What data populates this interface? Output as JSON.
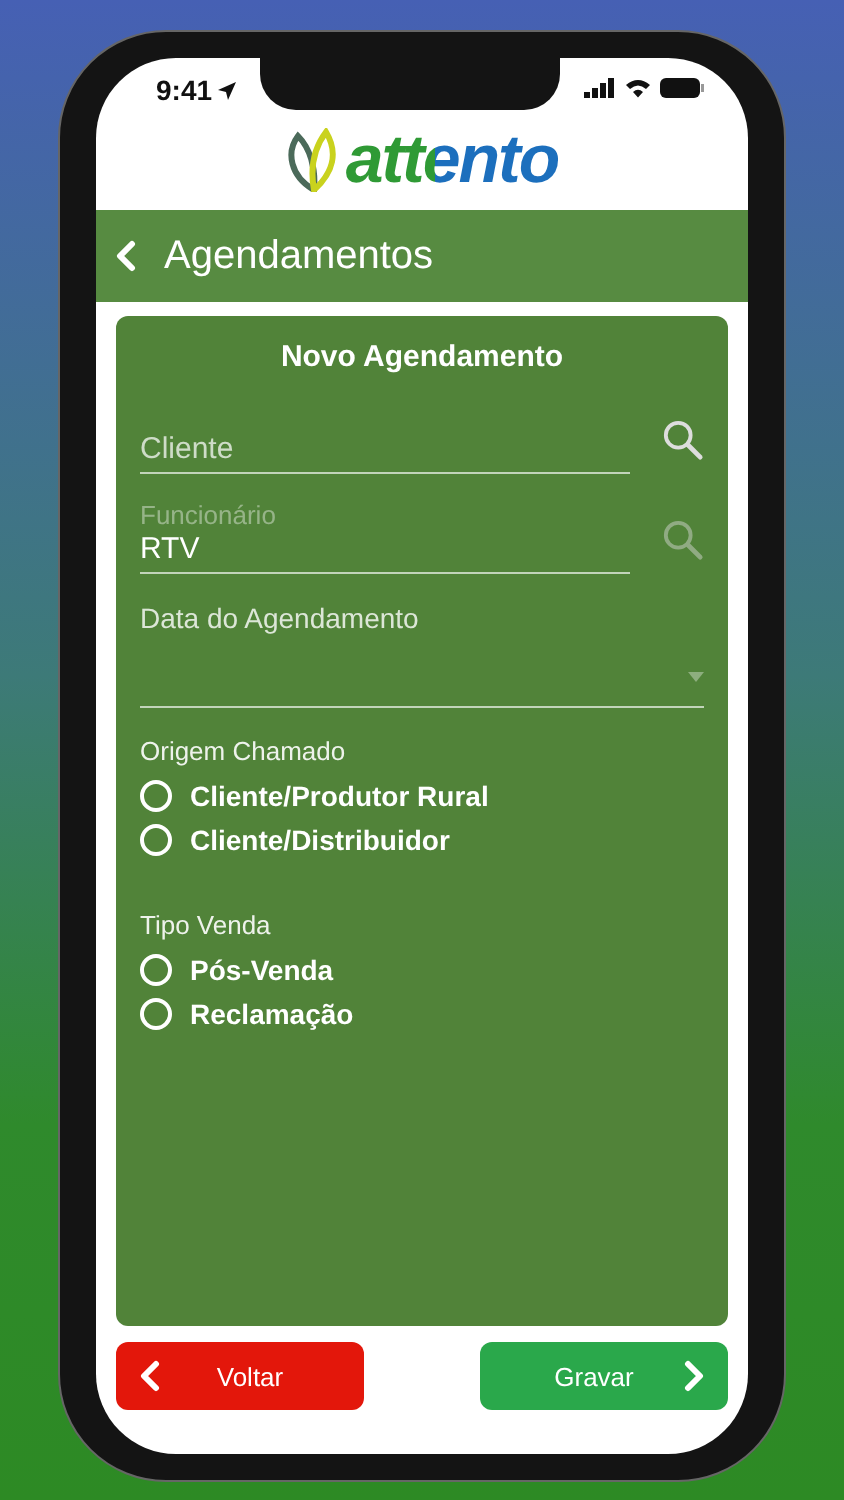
{
  "status_bar": {
    "time": "9:41"
  },
  "logo": {
    "text": "attento"
  },
  "header": {
    "title": "Agendamentos"
  },
  "form": {
    "title": "Novo Agendamento",
    "fields": [
      {
        "kind": "search",
        "placeholder": "Cliente",
        "disabled": false
      },
      {
        "kind": "search",
        "label": "Funcionário",
        "value": "RTV",
        "disabled": true
      },
      {
        "kind": "dropdown",
        "label": "Data do Agendamento"
      }
    ],
    "groups": [
      {
        "label": "Origem Chamado",
        "options": [
          {
            "label": "Cliente/Produtor Rural",
            "selected": false
          },
          {
            "label": "Cliente/Distribuidor",
            "selected": false
          }
        ]
      },
      {
        "label": "Tipo Venda",
        "options": [
          {
            "label": "Pós-Venda",
            "selected": false
          },
          {
            "label": "Reclamação",
            "selected": false
          }
        ]
      }
    ]
  },
  "buttons": [
    {
      "kind": "back",
      "label": "Voltar"
    },
    {
      "kind": "forward",
      "label": "Gravar"
    }
  ]
}
